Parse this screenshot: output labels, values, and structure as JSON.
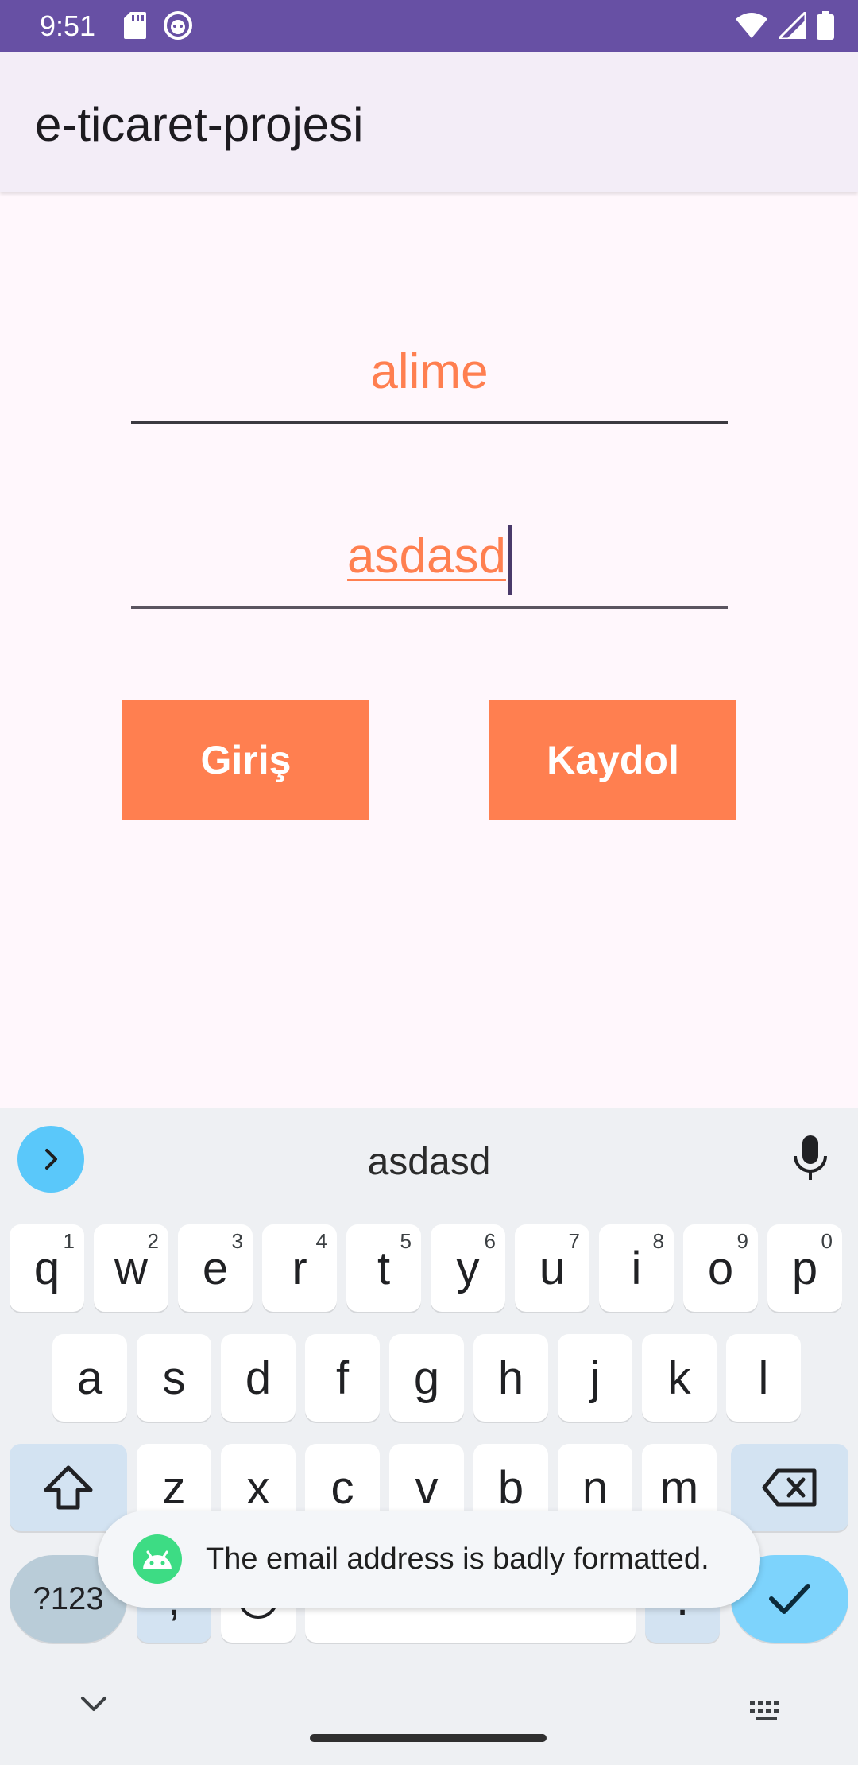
{
  "status_bar": {
    "time": "9:51",
    "left_icons": [
      "sd-card-icon",
      "android-debug-icon"
    ],
    "right_icons": [
      "wifi-icon",
      "cell-signal-icon",
      "battery-icon"
    ]
  },
  "app_bar": {
    "title": "e-ticaret-projesi"
  },
  "form": {
    "email_value": "alime",
    "password_value": "asdasd",
    "login_label": "Giriş",
    "signup_label": "Kaydol"
  },
  "keyboard": {
    "suggestion": "asdasd",
    "row1": [
      {
        "k": "q",
        "h": "1"
      },
      {
        "k": "w",
        "h": "2"
      },
      {
        "k": "e",
        "h": "3"
      },
      {
        "k": "r",
        "h": "4"
      },
      {
        "k": "t",
        "h": "5"
      },
      {
        "k": "y",
        "h": "6"
      },
      {
        "k": "u",
        "h": "7"
      },
      {
        "k": "i",
        "h": "8"
      },
      {
        "k": "o",
        "h": "9"
      },
      {
        "k": "p",
        "h": "0"
      }
    ],
    "row2": [
      "a",
      "s",
      "d",
      "f",
      "g",
      "h",
      "j",
      "k",
      "l"
    ],
    "row3": [
      "z",
      "x",
      "c",
      "v",
      "b",
      "n",
      "m"
    ],
    "symbols_label": "?123",
    "comma_label": ",",
    "period_label": "."
  },
  "toast": {
    "message": "The email address is badly formatted."
  },
  "colors": {
    "status_bar": "#6750A4",
    "accent": "#FF7F50",
    "app_bar": "#F3EDF7",
    "background": "#FFF7FC"
  }
}
